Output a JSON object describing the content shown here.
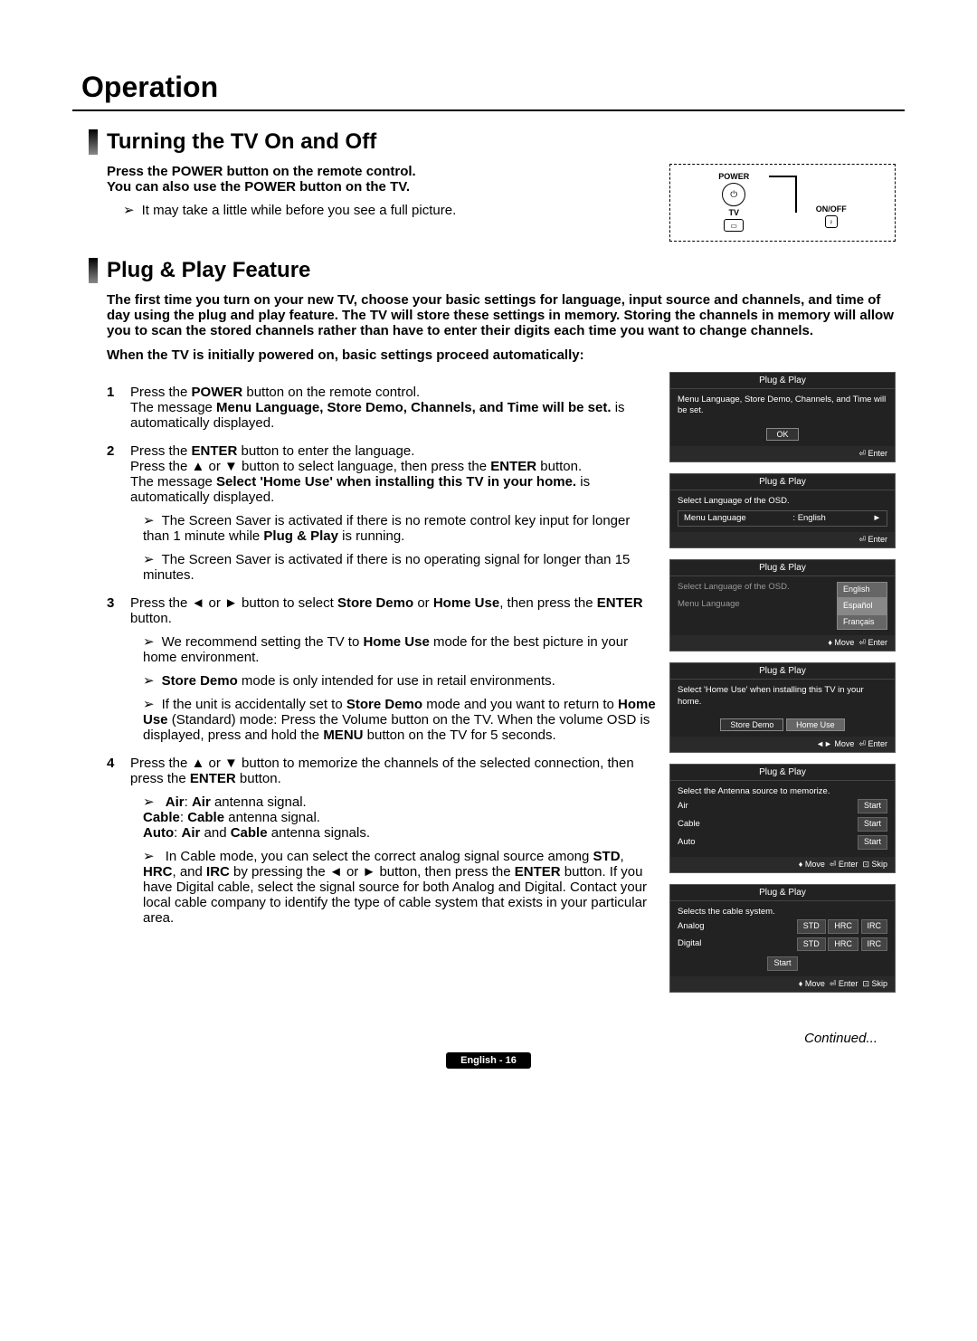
{
  "chapter": "Operation",
  "sec1": {
    "title": "Turning the TV On and Off",
    "intro1": "Press the POWER button on the remote control.",
    "intro2": "You can also use the POWER button on the TV.",
    "note": "It may take a little while before you see a full picture."
  },
  "remote": {
    "power": "POWER",
    "tv": "TV",
    "onoff": "ON/OFF"
  },
  "sec2": {
    "title": "Plug & Play Feature",
    "intro": "The first time you turn on your new TV, choose your basic settings for language, input source and channels, and time of day using the plug and play feature. The TV will store these settings in memory. Storing the channels in memory will allow you to scan the stored channels rather than have to enter their digits each time you want to change channels.",
    "intro2": "When the TV is initially powered on, basic settings proceed automatically:",
    "step1a": "Press the ",
    "step1b": "POWER",
    "step1c": " button on the remote control.",
    "step1d": "The message ",
    "step1e": "Menu Language, Store Demo, Channels, and Time will be set.",
    "step1f": " is automatically displayed.",
    "step2a": "Press the ",
    "step2b": "ENTER",
    "step2c": " button to enter the language.",
    "step2d": "Press the ▲ or ▼ button to select language, then press the ",
    "step2e": "ENTER",
    "step2f": " button.",
    "step2g": "The message ",
    "step2h": "Select 'Home Use' when installing this TV in your home.",
    "step2i": " is automatically displayed.",
    "step2n1a": "The Screen Saver is activated if there is no remote control key input for longer than 1 minute while ",
    "step2n1b": "Plug & Play",
    "step2n1c": " is running.",
    "step2n2": "The Screen Saver is activated if there is no operating signal for longer than 15 minutes.",
    "step3a": "Press the ◄ or ► button to select ",
    "step3b": "Store Demo",
    "step3c": " or ",
    "step3d": "Home Use",
    "step3e": ", then press the ",
    "step3f": "ENTER",
    "step3g": " button.",
    "step3n1a": "We recommend setting the TV to ",
    "step3n1b": "Home Use",
    "step3n1c": " mode for the best picture in your home environment.",
    "step3n2a": "Store Demo",
    "step3n2b": " mode is only intended for use in retail environments.",
    "step3n3a": "If the unit is accidentally set to ",
    "step3n3b": "Store Demo",
    "step3n3c": " mode and you want to return to ",
    "step3n3d": "Home Use",
    "step3n3e": " (Standard) mode: Press the Volume button on the TV. When the volume OSD is displayed, press and hold the ",
    "step3n3f": "MENU",
    "step3n3g": " button on the TV for 5 seconds.",
    "step4a": "Press the ▲ or ▼ button to memorize the channels of the selected connection, then press the ",
    "step4b": "ENTER",
    "step4c": " button.",
    "step4n1a": "Air",
    "step4n1b": ": ",
    "step4n1c": "Air",
    "step4n1d": " antenna signal.",
    "step4n1e": "Cable",
    "step4n1f": ": ",
    "step4n1g": "Cable",
    "step4n1h": " antenna signal.",
    "step4n1i": "Auto",
    "step4n1j": ": ",
    "step4n1k": "Air",
    "step4n1l": " and ",
    "step4n1m": "Cable",
    "step4n1n": " antenna signals.",
    "step4n2a": "In Cable mode, you can select the correct analog signal source among ",
    "step4n2b": "STD",
    "step4n2c": ", ",
    "step4n2d": "HRC",
    "step4n2e": ", and ",
    "step4n2f": "IRC",
    "step4n2g": " by pressing the ◄ or ► button, then press the ",
    "step4n2h": "ENTER",
    "step4n2i": " button. If you have Digital cable, select the signal source for both Analog and Digital. Contact your local cable company to identify the type of cable system that exists in your particular area."
  },
  "osd": {
    "pp": "Plug & Play",
    "s1": "Menu Language, Store Demo, Channels, and Time will be set.",
    "ok": "OK",
    "enter": "Enter",
    "s2": "Select Language of the OSD.",
    "menulang": "Menu Language",
    "english": "English",
    "espanol": "Español",
    "francais": "Français",
    "move": "Move",
    "s4": "Select 'Home Use' when installing this TV in your home.",
    "storedemo": "Store Demo",
    "homeuse": "Home Use",
    "s5": "Select the Antenna source to memorize.",
    "air": "Air",
    "cable": "Cable",
    "auto": "Auto",
    "start": "Start",
    "skip": "Skip",
    "s6": "Selects the cable system.",
    "analog": "Analog",
    "digital": "Digital",
    "std": "STD",
    "hrc": "HRC",
    "irc": "IRC"
  },
  "continued": "Continued...",
  "footer": "English - 16"
}
